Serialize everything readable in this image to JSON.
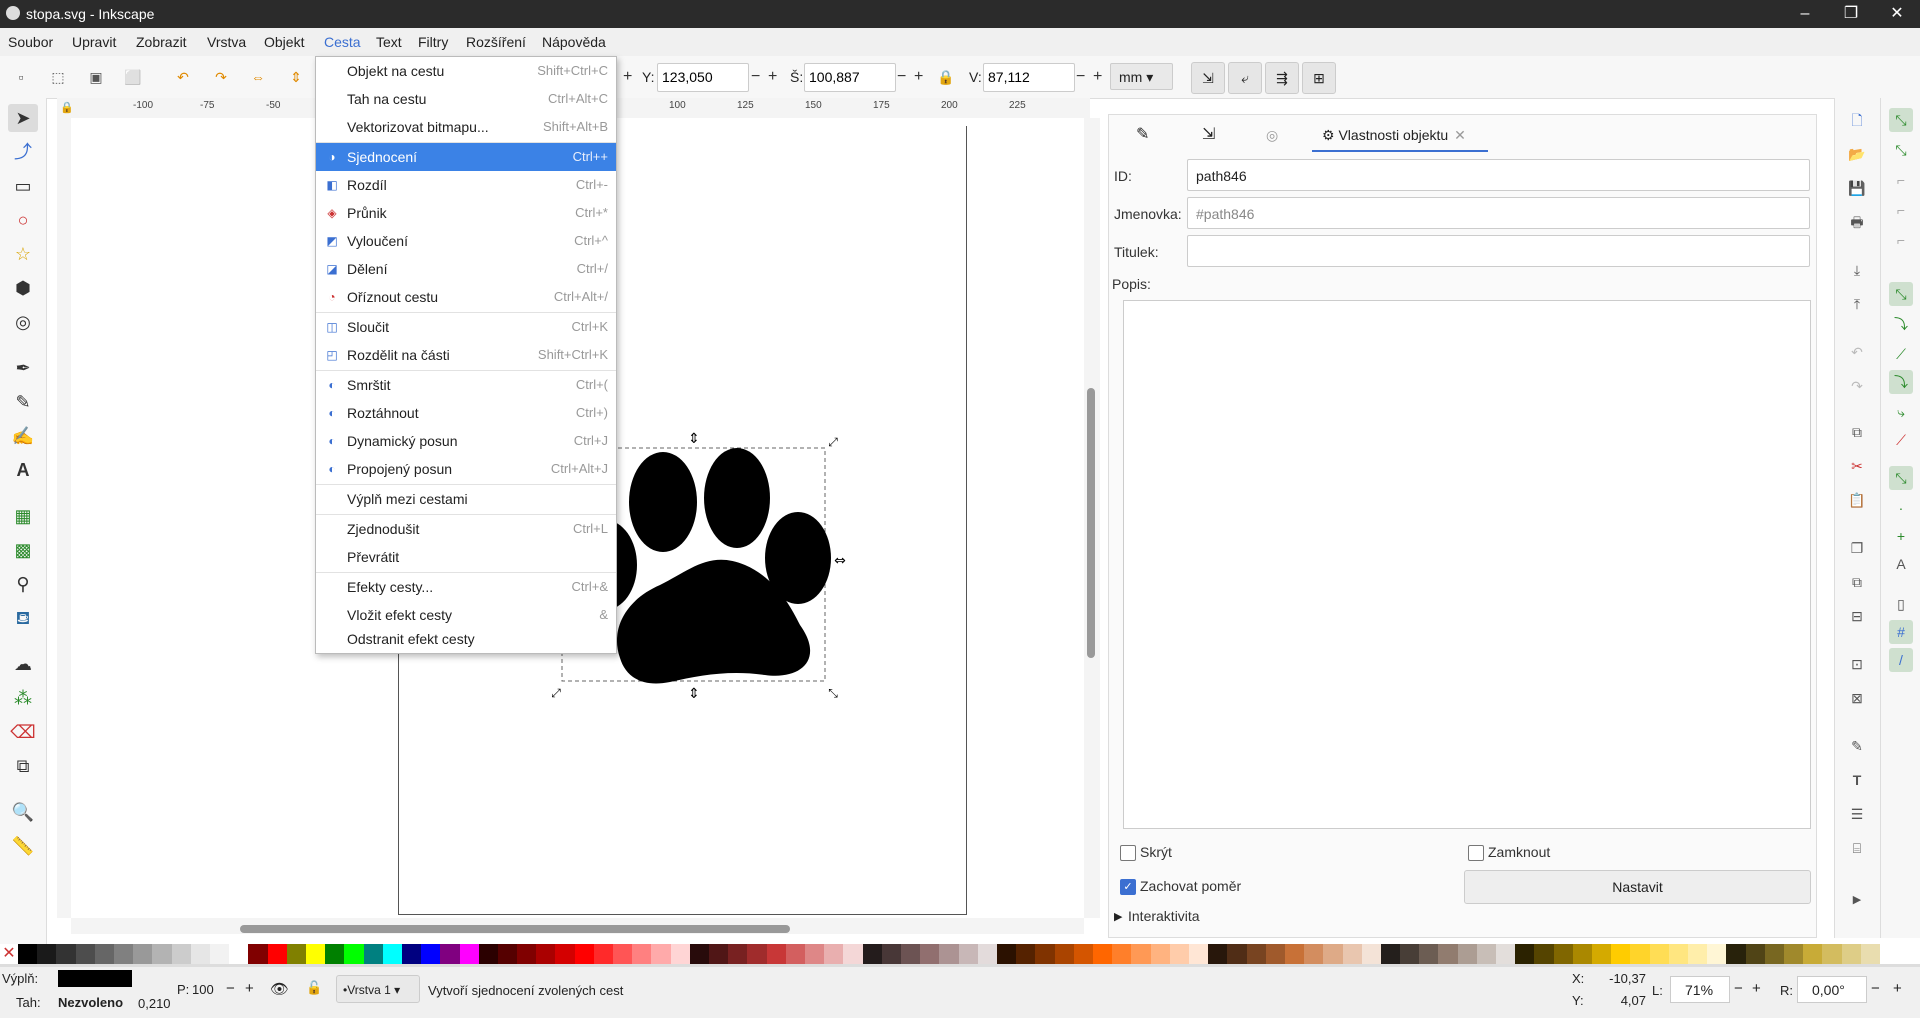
{
  "window": {
    "title": "stopa.svg - Inkscape"
  },
  "menubar": [
    "Soubor",
    "Upravit",
    "Zobrazit",
    "Vrstva",
    "Objekt",
    "Cesta",
    "Text",
    "Filtry",
    "Rozšíření",
    "Nápověda"
  ],
  "toolbar": {
    "y_label": "Y:",
    "y_value": "123,050",
    "w_label": "Š:",
    "w_value": "100,887",
    "h_label": "V:",
    "h_value": "87,112",
    "unit": "mm"
  },
  "ruler_ticks": [
    "-100",
    "-75",
    "-50",
    "100",
    "125",
    "150",
    "175",
    "200",
    "225"
  ],
  "path_menu": [
    {
      "label": "Objekt na cestu",
      "shortcut": "Shift+Ctrl+C",
      "icon": ""
    },
    {
      "label": "Tah na cestu",
      "shortcut": "Ctrl+Alt+C",
      "icon": ""
    },
    {
      "label": "Vektorizovat bitmapu...",
      "shortcut": "Shift+Alt+B",
      "icon": ""
    },
    {
      "label": "Sjednocení",
      "shortcut": "Ctrl++",
      "icon": "union-icon",
      "highlight": true
    },
    {
      "label": "Rozdíl",
      "shortcut": "Ctrl+-",
      "icon": "difference-icon"
    },
    {
      "label": "Průnik",
      "shortcut": "Ctrl+*",
      "icon": "intersection-icon"
    },
    {
      "label": "Vyloučení",
      "shortcut": "Ctrl+^",
      "icon": "exclusion-icon"
    },
    {
      "label": "Dělení",
      "shortcut": "Ctrl+/",
      "icon": "division-icon"
    },
    {
      "label": "Oříznout cestu",
      "shortcut": "Ctrl+Alt+/",
      "icon": "cut-path-icon"
    },
    {
      "label": "Sloučit",
      "shortcut": "Ctrl+K",
      "icon": "combine-icon"
    },
    {
      "label": "Rozdělit na části",
      "shortcut": "Shift+Ctrl+K",
      "icon": "break-apart-icon"
    },
    {
      "label": "Smrštit",
      "shortcut": "Ctrl+(",
      "icon": "inset-icon"
    },
    {
      "label": "Roztáhnout",
      "shortcut": "Ctrl+)",
      "icon": "outset-icon"
    },
    {
      "label": "Dynamický posun",
      "shortcut": "Ctrl+J",
      "icon": "dynamic-offset-icon"
    },
    {
      "label": "Propojený posun",
      "shortcut": "Ctrl+Alt+J",
      "icon": "linked-offset-icon"
    },
    {
      "label": "Výplň mezi cestami",
      "shortcut": "",
      "icon": ""
    },
    {
      "label": "Zjednodušit",
      "shortcut": "Ctrl+L",
      "icon": ""
    },
    {
      "label": "Převrátit",
      "shortcut": "",
      "icon": ""
    },
    {
      "label": "Efekty cesty...",
      "shortcut": "Ctrl+&",
      "icon": ""
    },
    {
      "label": "Vložit efekt cesty",
      "shortcut": "&",
      "icon": ""
    },
    {
      "label": "Odstranit efekt cesty",
      "shortcut": "",
      "icon": ""
    }
  ],
  "panel": {
    "tab_title": "Vlastnosti objektu",
    "id_label": "ID:",
    "id_value": "path846",
    "label_label": "Jmenovka:",
    "label_placeholder": "#path846",
    "title_label": "Titulek:",
    "desc_label": "Popis:",
    "hide_label": "Skrýt",
    "lock_label": "Zamknout",
    "keep_ratio_label": "Zachovat poměr",
    "set_button": "Nastavit",
    "interactivity_label": "Interaktivita",
    "keep_ratio_checked": true
  },
  "statusbar": {
    "fill_label": "Výplň:",
    "stroke_label": "Tah:",
    "stroke_value": "Nezvoleno",
    "stroke_width": "0,210",
    "opacity_label": "P:",
    "opacity_value": "100",
    "layer": "•Vrstva 1",
    "message": "Vytvoří sjednocení zvolených cest",
    "x_label": "X:",
    "x_value": "-10,37",
    "y_label": "Y:",
    "y_value": "4,07",
    "zoom_label": "L:",
    "zoom_value": "71%",
    "rotate_label": "R:",
    "rotate_value": "0,00°"
  },
  "palette": [
    "#000000",
    "#1a1a1a",
    "#333333",
    "#4d4d4d",
    "#666666",
    "#808080",
    "#999999",
    "#b3b3b3",
    "#cccccc",
    "#e6e6e6",
    "#f2f2f2",
    "#ffffff",
    "#800000",
    "#ff0000",
    "#808000",
    "#ffff00",
    "#008000",
    "#00ff00",
    "#008080",
    "#00ffff",
    "#000080",
    "#0000ff",
    "#800080",
    "#ff00ff",
    "#2b0000",
    "#550000",
    "#800000",
    "#aa0000",
    "#d40000",
    "#ff0000",
    "#ff2a2a",
    "#ff5555",
    "#ff8080",
    "#ffaaaa",
    "#ffd5d5",
    "#280b0b",
    "#501616",
    "#782121",
    "#a02c2c",
    "#c83737",
    "#d35f5f",
    "#de8787",
    "#e9afaf",
    "#f4d7d7",
    "#241c1c",
    "#483737",
    "#6c5353",
    "#916f6f",
    "#ac9393",
    "#c8b7b7",
    "#e3dbdb",
    "#2b1100",
    "#552200",
    "#803300",
    "#aa4400",
    "#d45500",
    "#ff6600",
    "#ff7f2a",
    "#ff9955",
    "#ffb380",
    "#ffccaa",
    "#ffe6d5",
    "#28170b",
    "#502d16",
    "#784421",
    "#a05a2c",
    "#c87137",
    "#d38d5f",
    "#deaa87",
    "#e9c6af",
    "#f4e3d7",
    "#241f1c",
    "#483e37",
    "#6c5d53",
    "#917c6f",
    "#ac9d93",
    "#c8beb7",
    "#e3dedb",
    "#2b2200",
    "#554400",
    "#806600",
    "#aa8800",
    "#d4aa00",
    "#ffcc00",
    "#ffd42a",
    "#ffdd55",
    "#ffe680",
    "#ffeeaa",
    "#fff6d5",
    "#28220b",
    "#504416",
    "#786721",
    "#a0892c",
    "#c8ab37",
    "#d3bc5f",
    "#decd87",
    "#e9ddaf"
  ]
}
